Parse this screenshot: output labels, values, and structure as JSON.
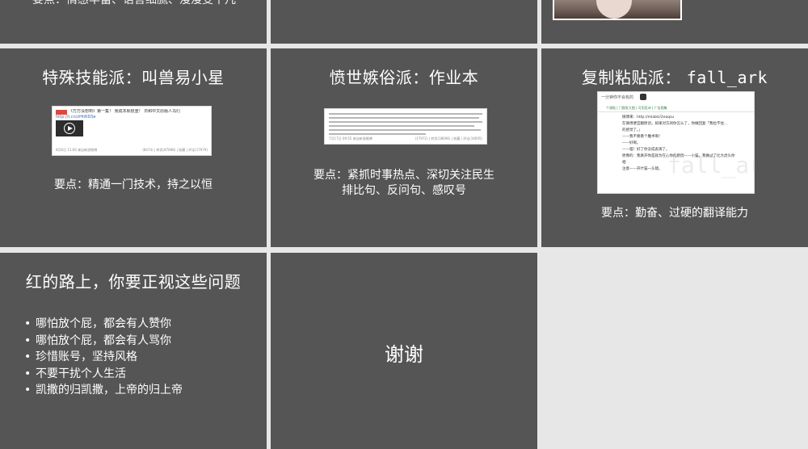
{
  "top_row": {
    "partial_text": "要点：情感丰富、语言细腻、漫漫变平凡"
  },
  "slides": {
    "skill": {
      "title": "特殊技能派：叫兽易小星",
      "thumb": {
        "post_text": "《万万没想到》第一集！ 我成本就很重！ 日和中文原版人马们",
        "post_link": "http://t.cn/zHhRDSe",
        "footer_left": "8月6日 11:00  来自新浪微博",
        "footer_right": "(8474) | 转发(87898) | 收藏 | 评论(17979)"
      },
      "keypoint": "要点：精通一门技术，持之以恒"
    },
    "cynic": {
      "title": "愤世嫉俗派：作业本",
      "thumb": {
        "footer_left": "7月17日 09:55  来自新浪微博",
        "footer_right": "(17972) | 转发(38696) | 收藏 | 评论(16695)"
      },
      "keypoint_lines": [
        "要点：紧抓时事热点、深切关注民生",
        "排比句、反问句、感叹号"
      ]
    },
    "copy": {
      "title_prefix": "复制粘贴派：",
      "title_handle": "fall_ark",
      "thumb": {
        "header": "一分钟你不会有的",
        "nav": "个演贴 | 门图发大图 | 可用否诗 | 广告图集",
        "body_lines": [
          "微博来：http://mlabU/2eaqsu",
          "在微博便宜翻原创，如果对方闲你怎么了，你做回复「我拉不住...",
          "的感觉了。」",
          "",
          "——我不要看个魔术啊！",
          "——好啊。",
          "——喵！好了你没成表演了。",
          "",
          "原像的：我真开你是就为在心你的原因——小猫，我做过了比大虎头你相",
          "注意——开什猫一头镜。"
        ],
        "watermark": "fall_ark"
      },
      "keypoint": "要点：勤奋、过硬的翻译能力"
    },
    "issues": {
      "title": "红的路上，你要正视这些问题",
      "bullets": [
        "哪怕放个屁，都会有人赞你",
        "哪怕放个屁，都会有人骂你",
        "珍惜账号，坚持风格",
        "不要干扰个人生活",
        "凯撒的归凯撒，上帝的归上帝"
      ]
    },
    "thanks": {
      "text": "谢谢"
    }
  }
}
